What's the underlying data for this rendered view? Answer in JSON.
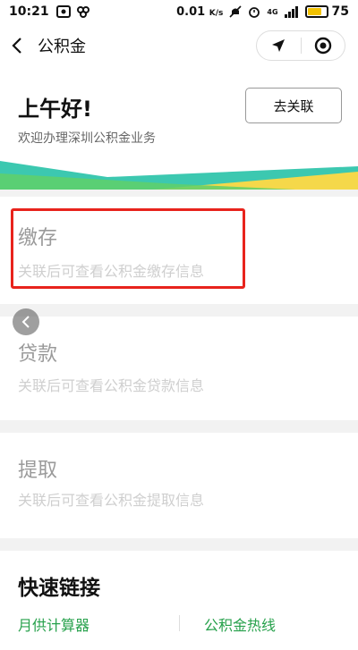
{
  "status_bar": {
    "time": "10:21",
    "speed": "0.01",
    "speed_unit": "K/s",
    "network": "4G",
    "battery": "75",
    "battery_level": 0.75
  },
  "nav": {
    "title": "公积金"
  },
  "header": {
    "greeting": "上午好!",
    "subtitle": "欢迎办理深圳公积金业务",
    "link_button": "去关联"
  },
  "cards": [
    {
      "title": "缴存",
      "desc": "关联后可查看公积金缴存信息"
    },
    {
      "title": "贷款",
      "desc": "关联后可查看公积金贷款信息"
    },
    {
      "title": "提取",
      "desc": "关联后可查看公积金提取信息"
    }
  ],
  "quick_links": {
    "title": "快速链接",
    "items": [
      "月供计算器",
      "公积金热线"
    ]
  },
  "colors": {
    "accent_green": "#27a14c",
    "highlight_red": "#e8231c",
    "wave_teal": "#3cc8b0",
    "wave_yellow": "#f5d84a"
  }
}
